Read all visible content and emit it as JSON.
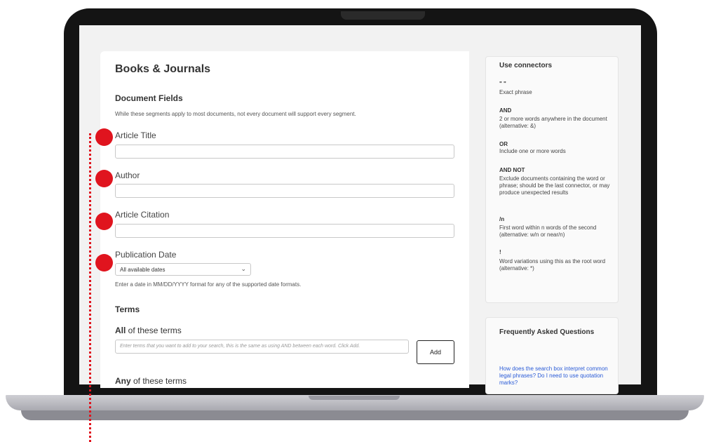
{
  "form": {
    "title": "Books & Journals",
    "section_heading": "Document Fields",
    "helper_text": "While these segments apply to most documents, not every document will support every segment.",
    "fields": [
      {
        "label": "Article Title",
        "value": ""
      },
      {
        "label": "Author",
        "value": ""
      },
      {
        "label": "Article Citation",
        "value": ""
      },
      {
        "label": "Publication Date",
        "value": "All available dates"
      }
    ],
    "date_hint": "Enter a date in MM/DD/YYYY format for any of the supported date formats.",
    "terms_heading": "Terms",
    "all_terms_bold": "All",
    "all_terms_rest": " of these terms",
    "terms_placeholder": "Enter terms that you want to add to your search, this is the same as using AND between each word. Click Add.",
    "add_label": "Add",
    "any_terms_bold": "Any",
    "any_terms_rest": " of these terms"
  },
  "connectors": {
    "heading": "Use connectors",
    "items": [
      {
        "symbol": "\" \"",
        "description": "Exact phrase"
      },
      {
        "symbol": "AND",
        "description": "2 or more words anywhere in the document (alternative: &)"
      },
      {
        "symbol": "OR",
        "description": "Include one or more words"
      },
      {
        "symbol": "AND NOT",
        "description": "Exclude documents containing the word or phrase; should be the last connector, or may produce unexpected results"
      },
      {
        "symbol": "/n",
        "description": "First word within n words of the second (alternative: w/n or near/n)"
      },
      {
        "symbol": "!",
        "description": "Word variations using this as the root word (alternative: *)"
      }
    ]
  },
  "faq": {
    "heading": "Frequently Asked Questions",
    "link": "How does the search box interpret common legal phrases? Do I need to use quotation marks?"
  },
  "colors": {
    "marker": "#e0141e",
    "link": "#2a5bd7",
    "laptop_bezel": "#141414"
  }
}
